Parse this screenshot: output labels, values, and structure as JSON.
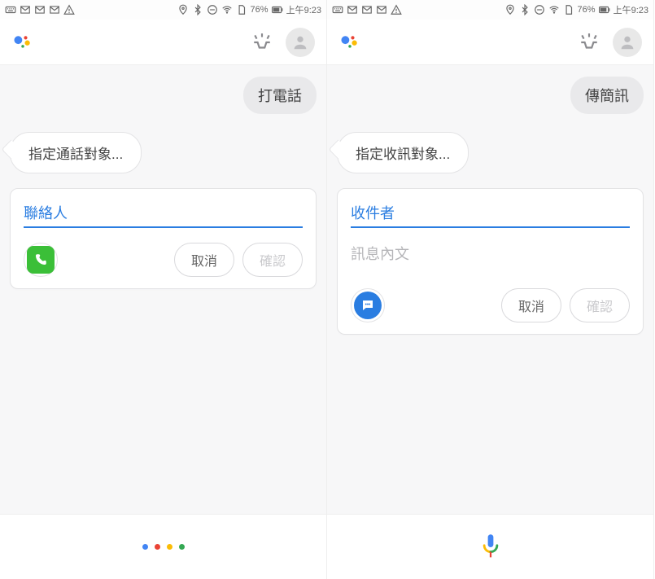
{
  "status": {
    "battery": "76%",
    "time": "上午9:23"
  },
  "left": {
    "user_bubble": "打電話",
    "assistant_bubble": "指定通話對象...",
    "card": {
      "field_label": "聯絡人",
      "cancel": "取消",
      "confirm": "確認"
    }
  },
  "right": {
    "user_bubble": "傳簡訊",
    "assistant_bubble": "指定收訊對象...",
    "card": {
      "field_label": "收件者",
      "body_placeholder": "訊息內文",
      "cancel": "取消",
      "confirm": "確認"
    }
  }
}
